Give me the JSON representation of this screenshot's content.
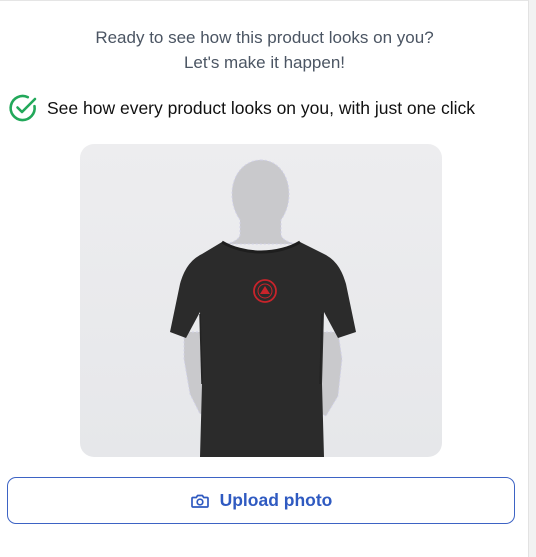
{
  "intro": {
    "line1": "Ready to see how this product looks on you?",
    "line2": "Let's make it happen!"
  },
  "benefit": {
    "icon": "check-circle-icon",
    "text": "See how every product looks on you, with just one click",
    "color": "#22a85a"
  },
  "preview": {
    "subject": "t-shirt-on-mannequin-silhouette"
  },
  "upload": {
    "icon": "camera-icon",
    "label": "Upload photo",
    "color": "#2f5ac1"
  }
}
